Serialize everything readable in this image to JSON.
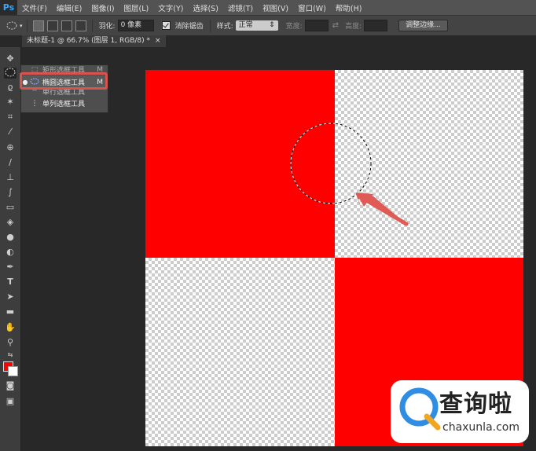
{
  "app": {
    "logo": "Ps"
  },
  "menu": [
    "文件(F)",
    "编辑(E)",
    "图像(I)",
    "图层(L)",
    "文字(Y)",
    "选择(S)",
    "滤镜(T)",
    "视图(V)",
    "窗口(W)",
    "帮助(H)"
  ],
  "options": {
    "feather_label": "羽化:",
    "feather_value": "0 像素",
    "antialias_label": "消除锯齿",
    "style_label": "样式:",
    "style_value": "正常",
    "width_label": "宽度:",
    "height_label": "高度:",
    "refine_button": "调整边缘..."
  },
  "document_tab": {
    "title": "未标题-1 @ 66.7% (图层 1, RGB/8) *",
    "close": "×"
  },
  "flyout": {
    "items": [
      {
        "label": "矩形选框工具",
        "shortcut": "M"
      },
      {
        "label": "椭圆选框工具",
        "shortcut": "M"
      },
      {
        "label": "单行选框工具",
        "shortcut": ""
      },
      {
        "label": "单列选框工具",
        "shortcut": ""
      }
    ]
  },
  "colors": {
    "foreground": "#ff0000",
    "background": "#ffffff",
    "canvas_fill": "#ff0000",
    "highlight": "#d9534f"
  },
  "watermark": {
    "brand": "查询啦",
    "url": "chaxunla.com"
  }
}
